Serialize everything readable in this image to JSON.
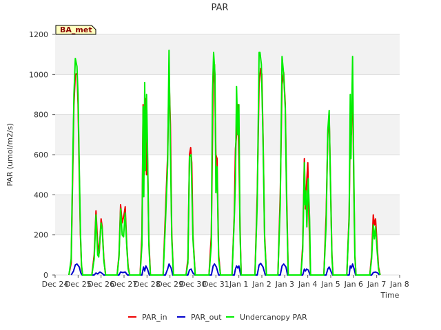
{
  "chart_data": {
    "type": "line",
    "title": "PAR",
    "xlabel": "Time",
    "ylabel": "PAR (umol/m2/s)",
    "badge": "BA_met",
    "xlim": [
      0,
      15
    ],
    "ylim": [
      0,
      1200
    ],
    "x_tick_labels": [
      "Dec 24",
      "Dec 25",
      "Dec 26",
      "Dec 27",
      "Dec 28",
      "Dec 29",
      "Dec 30",
      "Dec 31",
      "Jan 1",
      "Jan 2",
      "Jan 3",
      "Jan 4",
      "Jan 5",
      "Jan 6",
      "Jan 7",
      "Jan 8"
    ],
    "y_ticks": [
      0,
      200,
      400,
      600,
      800,
      1000,
      1200
    ],
    "grid": "horizontal, alternating bands",
    "legend_position": "bottom-center",
    "series": [
      {
        "name": "PAR_in",
        "color": "#ee0000",
        "points": [
          [
            0.6,
            0
          ],
          [
            0.7,
            60
          ],
          [
            0.75,
            400
          ],
          [
            0.82,
            850
          ],
          [
            0.88,
            1000
          ],
          [
            0.95,
            1005
          ],
          [
            1.0,
            850
          ],
          [
            1.05,
            500
          ],
          [
            1.1,
            200
          ],
          [
            1.15,
            40
          ],
          [
            1.2,
            0
          ],
          [
            1.6,
            0
          ],
          [
            1.7,
            100
          ],
          [
            1.78,
            320
          ],
          [
            1.85,
            160
          ],
          [
            1.92,
            110
          ],
          [
            2.0,
            280
          ],
          [
            2.05,
            240
          ],
          [
            2.12,
            80
          ],
          [
            2.2,
            0
          ],
          [
            2.7,
            0
          ],
          [
            2.78,
            100
          ],
          [
            2.85,
            350
          ],
          [
            2.92,
            260
          ],
          [
            3.0,
            300
          ],
          [
            3.05,
            340
          ],
          [
            3.12,
            150
          ],
          [
            3.18,
            40
          ],
          [
            3.25,
            0
          ],
          [
            3.7,
            0
          ],
          [
            3.78,
            200
          ],
          [
            3.83,
            850
          ],
          [
            3.88,
            500
          ],
          [
            3.93,
            880
          ],
          [
            3.98,
            500
          ],
          [
            4.02,
            600
          ],
          [
            4.08,
            180
          ],
          [
            4.15,
            0
          ],
          [
            4.7,
            0
          ],
          [
            4.8,
            300
          ],
          [
            4.9,
            600
          ],
          [
            4.96,
            1000
          ],
          [
            5.02,
            750
          ],
          [
            5.08,
            200
          ],
          [
            5.15,
            0
          ],
          [
            5.7,
            0
          ],
          [
            5.78,
            80
          ],
          [
            5.85,
            600
          ],
          [
            5.9,
            635
          ],
          [
            5.95,
            560
          ],
          [
            6.0,
            200
          ],
          [
            6.1,
            0
          ],
          [
            6.7,
            0
          ],
          [
            6.8,
            200
          ],
          [
            6.88,
            950
          ],
          [
            6.94,
            1050
          ],
          [
            7.0,
            600
          ],
          [
            7.05,
            580
          ],
          [
            7.12,
            100
          ],
          [
            7.2,
            0
          ],
          [
            7.7,
            0
          ],
          [
            7.8,
            300
          ],
          [
            7.85,
            630
          ],
          [
            7.9,
            700
          ],
          [
            7.95,
            850
          ],
          [
            8.0,
            600
          ],
          [
            8.05,
            250
          ],
          [
            8.1,
            0
          ],
          [
            8.7,
            0
          ],
          [
            8.8,
            400
          ],
          [
            8.88,
            950
          ],
          [
            8.95,
            1030
          ],
          [
            9.0,
            1000
          ],
          [
            9.05,
            700
          ],
          [
            9.12,
            200
          ],
          [
            9.2,
            0
          ],
          [
            9.7,
            0
          ],
          [
            9.8,
            400
          ],
          [
            9.88,
            950
          ],
          [
            9.95,
            1010
          ],
          [
            10.02,
            850
          ],
          [
            10.08,
            400
          ],
          [
            10.15,
            0
          ],
          [
            10.7,
            0
          ],
          [
            10.78,
            150
          ],
          [
            10.85,
            580
          ],
          [
            10.9,
            330
          ],
          [
            10.95,
            460
          ],
          [
            11.0,
            560
          ],
          [
            11.05,
            300
          ],
          [
            11.12,
            0
          ],
          [
            11.7,
            0
          ],
          [
            11.8,
            300
          ],
          [
            11.87,
            700
          ],
          [
            11.93,
            800
          ],
          [
            12.0,
            400
          ],
          [
            12.05,
            100
          ],
          [
            12.1,
            0
          ],
          [
            12.7,
            0
          ],
          [
            12.8,
            300
          ],
          [
            12.85,
            750
          ],
          [
            12.9,
            700
          ],
          [
            12.95,
            1000
          ],
          [
            13.0,
            480
          ],
          [
            13.05,
            100
          ],
          [
            13.1,
            0
          ],
          [
            13.7,
            0
          ],
          [
            13.78,
            100
          ],
          [
            13.85,
            300
          ],
          [
            13.9,
            250
          ],
          [
            13.95,
            280
          ],
          [
            14.02,
            150
          ],
          [
            14.08,
            40
          ],
          [
            14.15,
            0
          ]
        ]
      },
      {
        "name": "PAR_out",
        "color": "#0000cc",
        "points": [
          [
            0.7,
            0
          ],
          [
            0.8,
            20
          ],
          [
            0.88,
            50
          ],
          [
            0.95,
            55
          ],
          [
            1.05,
            40
          ],
          [
            1.12,
            10
          ],
          [
            1.18,
            0
          ],
          [
            1.7,
            0
          ],
          [
            1.78,
            10
          ],
          [
            1.85,
            5
          ],
          [
            1.95,
            15
          ],
          [
            2.05,
            8
          ],
          [
            2.12,
            0
          ],
          [
            2.78,
            0
          ],
          [
            2.85,
            15
          ],
          [
            2.95,
            12
          ],
          [
            3.05,
            15
          ],
          [
            3.15,
            0
          ],
          [
            3.78,
            0
          ],
          [
            3.85,
            40
          ],
          [
            3.9,
            20
          ],
          [
            3.95,
            45
          ],
          [
            4.02,
            30
          ],
          [
            4.1,
            0
          ],
          [
            4.8,
            0
          ],
          [
            4.9,
            30
          ],
          [
            4.96,
            55
          ],
          [
            5.05,
            35
          ],
          [
            5.12,
            0
          ],
          [
            5.78,
            0
          ],
          [
            5.85,
            25
          ],
          [
            5.92,
            30
          ],
          [
            6.0,
            10
          ],
          [
            6.08,
            0
          ],
          [
            6.8,
            0
          ],
          [
            6.88,
            45
          ],
          [
            6.94,
            55
          ],
          [
            7.02,
            40
          ],
          [
            7.12,
            0
          ],
          [
            7.8,
            0
          ],
          [
            7.85,
            30
          ],
          [
            7.9,
            45
          ],
          [
            7.95,
            35
          ],
          [
            8.0,
            45
          ],
          [
            8.08,
            0
          ],
          [
            8.8,
            0
          ],
          [
            8.88,
            50
          ],
          [
            8.95,
            58
          ],
          [
            9.05,
            40
          ],
          [
            9.15,
            0
          ],
          [
            9.8,
            0
          ],
          [
            9.88,
            45
          ],
          [
            9.95,
            55
          ],
          [
            10.05,
            40
          ],
          [
            10.12,
            0
          ],
          [
            10.78,
            0
          ],
          [
            10.85,
            30
          ],
          [
            10.9,
            20
          ],
          [
            10.95,
            30
          ],
          [
            11.02,
            25
          ],
          [
            11.1,
            0
          ],
          [
            11.8,
            0
          ],
          [
            11.87,
            30
          ],
          [
            11.93,
            40
          ],
          [
            12.02,
            15
          ],
          [
            12.08,
            0
          ],
          [
            12.8,
            0
          ],
          [
            12.85,
            45
          ],
          [
            12.9,
            35
          ],
          [
            12.95,
            55
          ],
          [
            13.02,
            30
          ],
          [
            13.08,
            0
          ],
          [
            13.78,
            0
          ],
          [
            13.85,
            12
          ],
          [
            13.95,
            15
          ],
          [
            14.05,
            10
          ],
          [
            14.12,
            0
          ]
        ]
      },
      {
        "name": "Undercanopy PAR",
        "color": "#00ee00",
        "points": [
          [
            0.6,
            0
          ],
          [
            0.7,
            80
          ],
          [
            0.75,
            450
          ],
          [
            0.82,
            900
          ],
          [
            0.88,
            1080
          ],
          [
            0.95,
            1040
          ],
          [
            1.0,
            900
          ],
          [
            1.05,
            550
          ],
          [
            1.1,
            220
          ],
          [
            1.15,
            50
          ],
          [
            1.2,
            0
          ],
          [
            1.6,
            0
          ],
          [
            1.7,
            80
          ],
          [
            1.78,
            300
          ],
          [
            1.85,
            100
          ],
          [
            1.9,
            90
          ],
          [
            2.0,
            260
          ],
          [
            2.05,
            230
          ],
          [
            2.12,
            70
          ],
          [
            2.2,
            0
          ],
          [
            2.7,
            0
          ],
          [
            2.78,
            90
          ],
          [
            2.85,
            330
          ],
          [
            2.92,
            200
          ],
          [
            2.98,
            190
          ],
          [
            3.05,
            310
          ],
          [
            3.12,
            140
          ],
          [
            3.18,
            30
          ],
          [
            3.25,
            0
          ],
          [
            3.7,
            0
          ],
          [
            3.78,
            150
          ],
          [
            3.83,
            840
          ],
          [
            3.86,
            390
          ],
          [
            3.9,
            960
          ],
          [
            3.93,
            520
          ],
          [
            3.98,
            900
          ],
          [
            4.02,
            650
          ],
          [
            4.08,
            150
          ],
          [
            4.15,
            0
          ],
          [
            4.7,
            0
          ],
          [
            4.8,
            250
          ],
          [
            4.9,
            550
          ],
          [
            4.96,
            1120
          ],
          [
            5.02,
            620
          ],
          [
            5.08,
            180
          ],
          [
            5.15,
            0
          ],
          [
            5.7,
            0
          ],
          [
            5.78,
            60
          ],
          [
            5.85,
            590
          ],
          [
            5.92,
            600
          ],
          [
            6.0,
            180
          ],
          [
            6.1,
            0
          ],
          [
            6.7,
            0
          ],
          [
            6.8,
            150
          ],
          [
            6.85,
            900
          ],
          [
            6.9,
            1110
          ],
          [
            6.96,
            1000
          ],
          [
            7.0,
            410
          ],
          [
            7.05,
            540
          ],
          [
            7.12,
            80
          ],
          [
            7.2,
            0
          ],
          [
            7.7,
            0
          ],
          [
            7.8,
            280
          ],
          [
            7.85,
            470
          ],
          [
            7.9,
            940
          ],
          [
            7.95,
            700
          ],
          [
            8.0,
            850
          ],
          [
            8.05,
            220
          ],
          [
            8.1,
            0
          ],
          [
            8.7,
            0
          ],
          [
            8.8,
            350
          ],
          [
            8.88,
            1110
          ],
          [
            8.92,
            1110
          ],
          [
            8.98,
            1050
          ],
          [
            9.05,
            680
          ],
          [
            9.12,
            180
          ],
          [
            9.2,
            0
          ],
          [
            9.7,
            0
          ],
          [
            9.8,
            350
          ],
          [
            9.88,
            1090
          ],
          [
            9.95,
            1000
          ],
          [
            10.02,
            830
          ],
          [
            10.08,
            350
          ],
          [
            10.15,
            0
          ],
          [
            10.7,
            0
          ],
          [
            10.78,
            120
          ],
          [
            10.85,
            560
          ],
          [
            10.88,
            350
          ],
          [
            10.92,
            420
          ],
          [
            10.96,
            240
          ],
          [
            11.02,
            480
          ],
          [
            11.08,
            280
          ],
          [
            11.12,
            0
          ],
          [
            11.7,
            0
          ],
          [
            11.8,
            250
          ],
          [
            11.87,
            720
          ],
          [
            11.93,
            820
          ],
          [
            12.0,
            380
          ],
          [
            12.05,
            90
          ],
          [
            12.1,
            0
          ],
          [
            12.7,
            0
          ],
          [
            12.8,
            280
          ],
          [
            12.85,
            900
          ],
          [
            12.88,
            580
          ],
          [
            12.95,
            1090
          ],
          [
            13.0,
            550
          ],
          [
            13.05,
            90
          ],
          [
            13.1,
            0
          ],
          [
            13.7,
            0
          ],
          [
            13.78,
            80
          ],
          [
            13.85,
            250
          ],
          [
            13.9,
            180
          ],
          [
            13.95,
            240
          ],
          [
            14.02,
            120
          ],
          [
            14.08,
            30
          ],
          [
            14.15,
            0
          ]
        ]
      }
    ]
  }
}
